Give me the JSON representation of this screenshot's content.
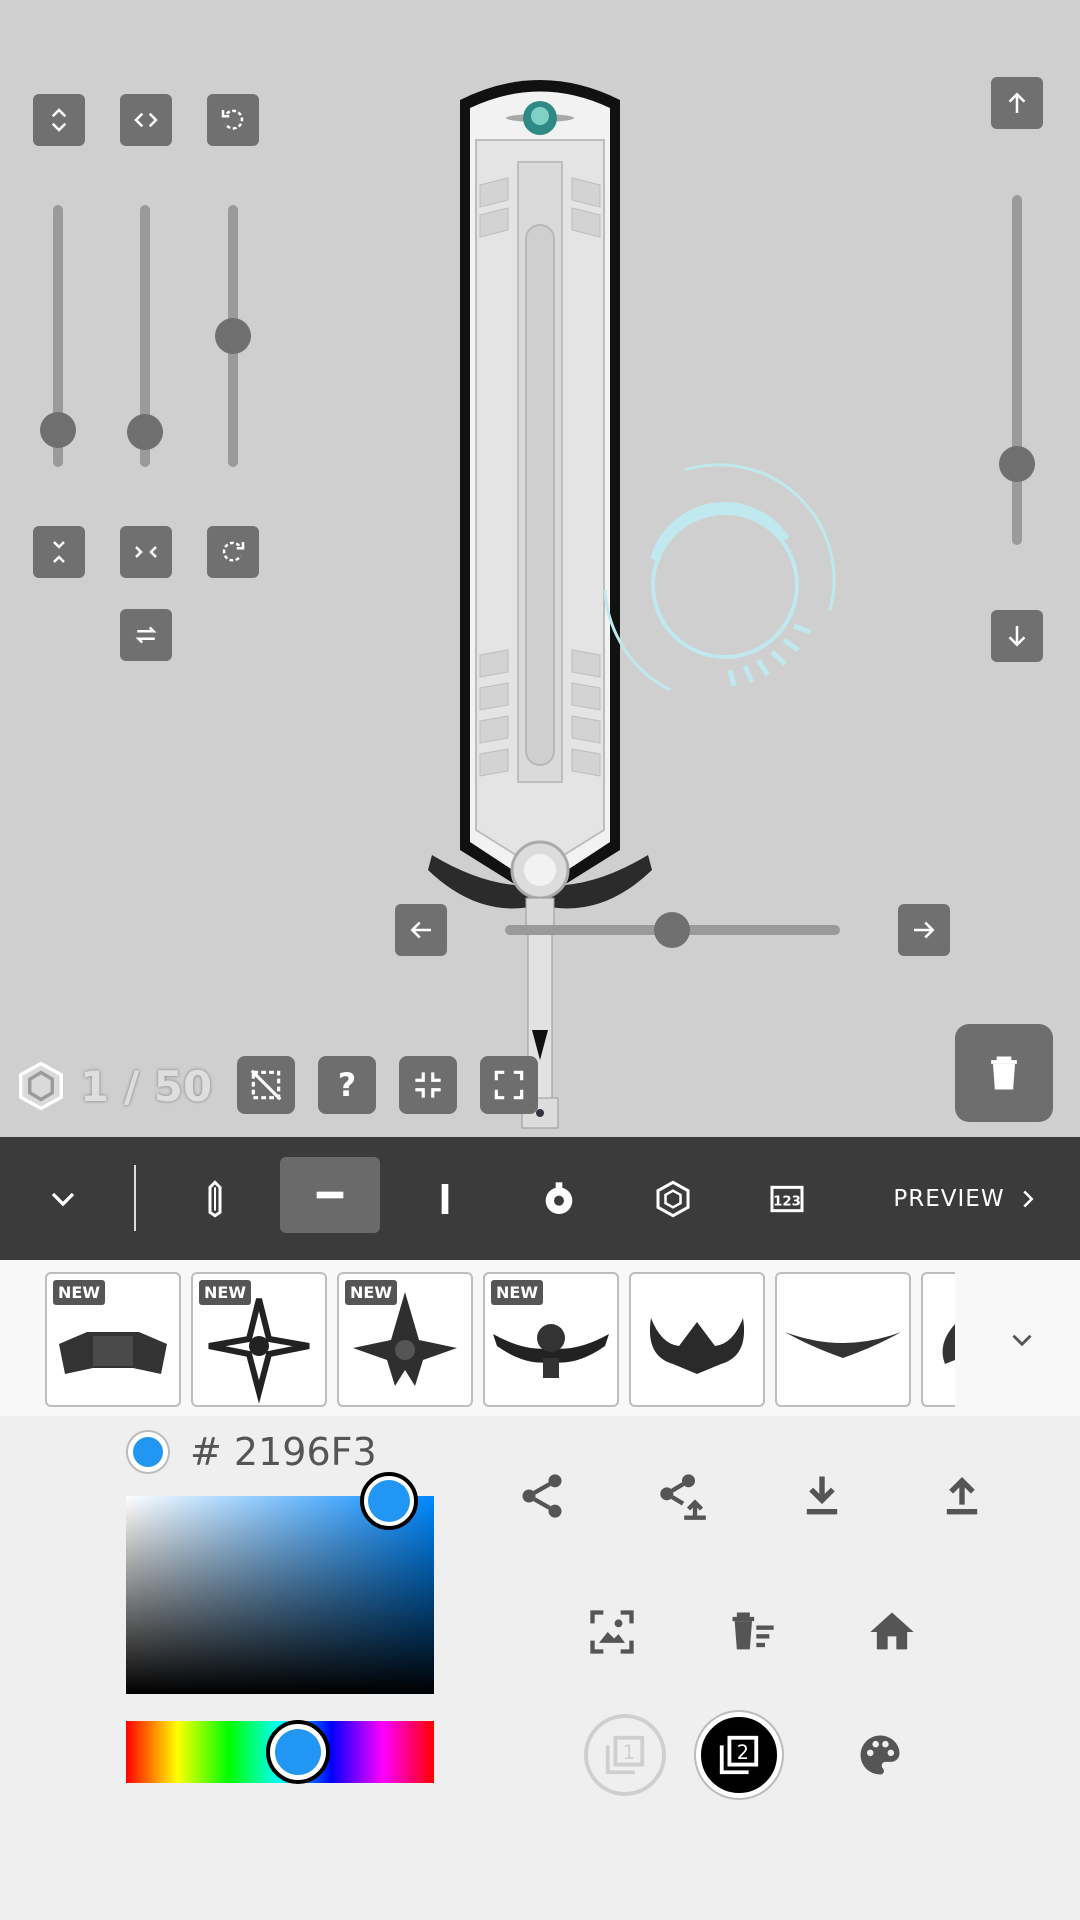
{
  "canvas": {
    "counter": "1 / 50",
    "hud_color": "#bfe9ee"
  },
  "sliders": {
    "left": [
      0.18,
      0.14,
      0.5
    ],
    "right_vertical": 0.23,
    "horizontal": 0.5
  },
  "toolbar": {
    "preview_label": "PREVIEW",
    "selected_index": 1,
    "items": [
      "collapse-icon",
      "blade-icon",
      "guard-icon",
      "grip-icon",
      "pommel-icon",
      "gem-icon",
      "number-icon"
    ]
  },
  "parts": [
    {
      "name": "guard-part-1",
      "badge": "NEW"
    },
    {
      "name": "guard-part-2",
      "badge": "NEW"
    },
    {
      "name": "guard-part-3",
      "badge": "NEW"
    },
    {
      "name": "guard-part-4",
      "badge": "NEW"
    },
    {
      "name": "guard-part-5",
      "badge": ""
    },
    {
      "name": "guard-part-6",
      "badge": ""
    }
  ],
  "color_picker": {
    "hex_label": "# 2196F3",
    "selected_color": "#2196F3"
  },
  "layers": {
    "layer1": "1",
    "layer2": "2",
    "active": "2"
  }
}
